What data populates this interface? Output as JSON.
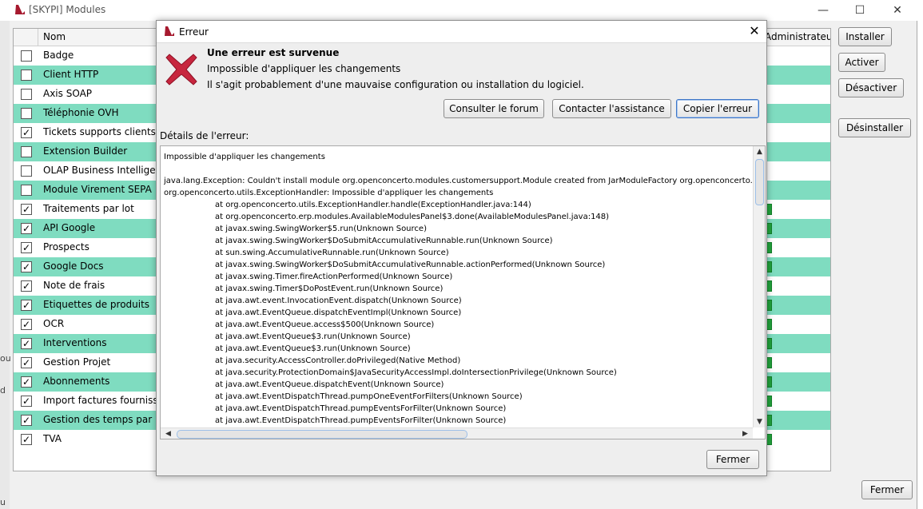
{
  "main_window": {
    "title": "[SKYPI] Modules",
    "controls": {
      "minimize": "—",
      "maximize": "☐",
      "close": "✕"
    },
    "left_fragments": [
      "ou",
      "d",
      "u"
    ],
    "table": {
      "headers": {
        "name": "Nom",
        "admin": "Administrateur"
      },
      "rows": [
        {
          "label": "Badge",
          "checked": false,
          "green": false,
          "status": false
        },
        {
          "label": "Client HTTP",
          "checked": false,
          "green": true,
          "status": false
        },
        {
          "label": "Axis SOAP",
          "checked": false,
          "green": false,
          "status": false
        },
        {
          "label": "Téléphonie OVH",
          "checked": false,
          "green": true,
          "status": false
        },
        {
          "label": "Tickets supports clients",
          "checked": true,
          "green": false,
          "status": false
        },
        {
          "label": "Extension Builder",
          "checked": false,
          "green": true,
          "status": false
        },
        {
          "label": "OLAP Business Intelligence",
          "checked": false,
          "green": false,
          "status": false
        },
        {
          "label": "Module Virement SEPA",
          "checked": false,
          "green": true,
          "status": false
        },
        {
          "label": "Traitements par lot",
          "checked": true,
          "green": false,
          "status": true
        },
        {
          "label": "API Google",
          "checked": true,
          "green": true,
          "status": true
        },
        {
          "label": "Prospects",
          "checked": true,
          "green": false,
          "status": true
        },
        {
          "label": "Google Docs",
          "checked": true,
          "green": true,
          "status": true
        },
        {
          "label": "Note de frais",
          "checked": true,
          "green": false,
          "status": true
        },
        {
          "label": "Etiquettes de produits",
          "checked": true,
          "green": true,
          "status": true
        },
        {
          "label": "OCR",
          "checked": true,
          "green": false,
          "status": true
        },
        {
          "label": "Interventions",
          "checked": true,
          "green": true,
          "status": true
        },
        {
          "label": "Gestion Projet",
          "checked": true,
          "green": false,
          "status": true
        },
        {
          "label": "Abonnements",
          "checked": true,
          "green": true,
          "status": true
        },
        {
          "label": "Import factures fournisseurs",
          "checked": true,
          "green": false,
          "status": true
        },
        {
          "label": "Gestion des temps par projet",
          "checked": true,
          "green": true,
          "status": true
        },
        {
          "label": "TVA",
          "checked": true,
          "green": false,
          "status": true
        }
      ]
    },
    "buttons": {
      "install": "Installer",
      "activate": "Activer",
      "deactivate": "Désactiver",
      "uninstall": "Désinstaller",
      "close": "Fermer"
    }
  },
  "dialog": {
    "title": "Erreur",
    "close_glyph": "✕",
    "heading": "Une erreur est survenue",
    "message1": "Impossible d'appliquer les changements",
    "message2": "Il s'agit probablement d'une mauvaise configuration ou installation du logiciel.",
    "buttons": {
      "forum": "Consulter le forum",
      "support": "Contacter l'assistance",
      "copy": "Copier l'erreur",
      "close": "Fermer"
    },
    "details_label": "Détails de l'erreur:",
    "details_lines": [
      "Impossible d'appliquer les changements",
      "",
      "java.lang.Exception: Couldn't install module org.openconcerto.modules.customersupport.Module created from JarModuleFactory org.openconcerto.module",
      "org.openconcerto.utils.ExceptionHandler: Impossible d'appliquer les changements",
      "at org.openconcerto.utils.ExceptionHandler.handle(ExceptionHandler.java:144)",
      "at org.openconcerto.erp.modules.AvailableModulesPanel$3.done(AvailableModulesPanel.java:148)",
      "at javax.swing.SwingWorker$5.run(Unknown Source)",
      "at javax.swing.SwingWorker$DoSubmitAccumulativeRunnable.run(Unknown Source)",
      "at sun.swing.AccumulativeRunnable.run(Unknown Source)",
      "at javax.swing.SwingWorker$DoSubmitAccumulativeRunnable.actionPerformed(Unknown Source)",
      "at javax.swing.Timer.fireActionPerformed(Unknown Source)",
      "at javax.swing.Timer$DoPostEvent.run(Unknown Source)",
      "at java.awt.event.InvocationEvent.dispatch(Unknown Source)",
      "at java.awt.EventQueue.dispatchEventImpl(Unknown Source)",
      "at java.awt.EventQueue.access$500(Unknown Source)",
      "at java.awt.EventQueue$3.run(Unknown Source)",
      "at java.awt.EventQueue$3.run(Unknown Source)",
      "at java.security.AccessController.doPrivileged(Native Method)",
      "at java.security.ProtectionDomain$JavaSecurityAccessImpl.doIntersectionPrivilege(Unknown Source)",
      "at java.awt.EventQueue.dispatchEvent(Unknown Source)",
      "at java.awt.EventDispatchThread.pumpOneEventForFilters(Unknown Source)",
      "at java.awt.EventDispatchThread.pumpEventsForFilter(Unknown Source)",
      "at java.awt.EventDispatchThread.pumpEventsForFilter(Unknown Source)"
    ]
  },
  "colors": {
    "row_highlight": "#7fdcc0",
    "status_active": "#21a33c",
    "error_icon": "#c7263e",
    "logo": "#a6192e"
  },
  "icons": {
    "app_logo": "app-logo-icon",
    "error": "error-x-icon",
    "checkbox": "checkmark-icon"
  }
}
